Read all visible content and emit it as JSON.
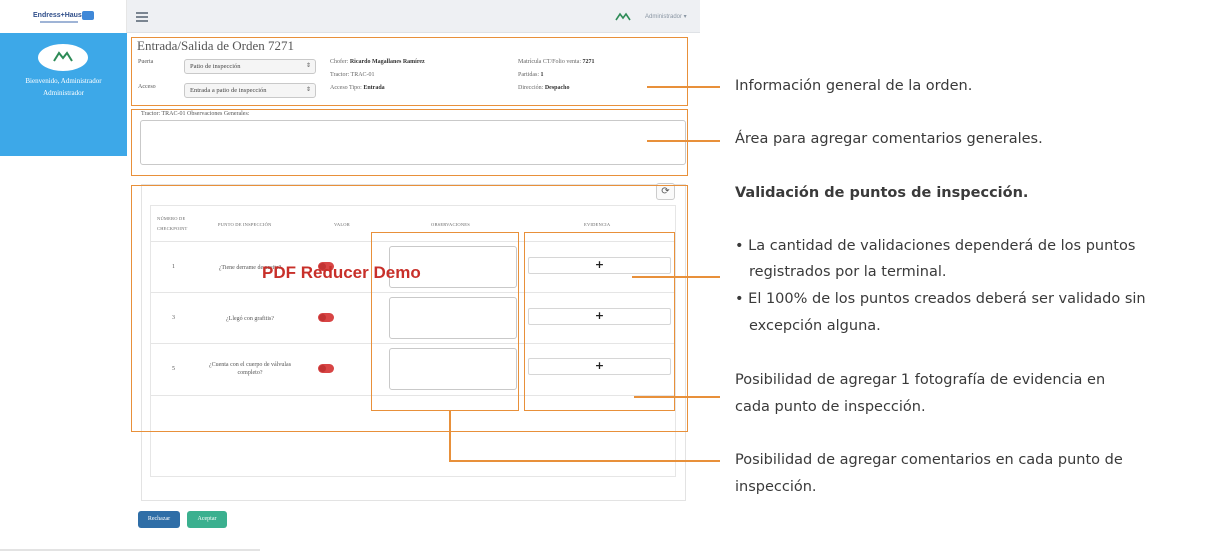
{
  "app": {
    "brand": "Endress+Hauser",
    "admin_menu": "Administrador ▾",
    "sidebar": {
      "welcome_line1": "Bienvenido, Administrador",
      "welcome_line2": "Administrador"
    },
    "page_title": "Entrada/Salida de Orden 7271",
    "form": {
      "puerta_label": "Puerta",
      "puerta_value": "Patio de inspección",
      "acceso_label": "Acceso",
      "acceso_value": "Entrada a patio de inspección",
      "chofer_label": "Chofer:",
      "chofer_value": "Ricardo Magallanes Ramírez",
      "tractor_label": "Tractor:",
      "tractor_value": "TRAC-01",
      "acceso_tipo_label": "Acceso Tipo:",
      "acceso_tipo_value": "Entrada",
      "matricula_label": "Matrícula CT/Folio venta:",
      "matricula_value": "7271",
      "partidas_label": "Partidas:",
      "partidas_value": "1",
      "direccion_label": "Dirección:",
      "direccion_value": "Despacho"
    },
    "observations_label": "Tractor: TRAC-01 Observaciones Generales:",
    "table": {
      "headers": {
        "numero": "Número de checkpoint",
        "punto": "Punto de inspección",
        "valor": "Valor",
        "observaciones": "Observaciones",
        "evidencia": "Evidencia"
      },
      "rows": [
        {
          "num": "1",
          "point": "¿Tiene derrame de aceite?"
        },
        {
          "num": "3",
          "point": "¿Llegó con grafitis?"
        },
        {
          "num": "5",
          "point": "¿Cuenta con el cuerpo de válvulas completo?"
        }
      ],
      "evidence_symbol": "+",
      "refresh_symbol": "⟳"
    },
    "buttons": {
      "reject": "Rechazar",
      "accept": "Aceptar"
    },
    "watermark": "PDF Reducer Demo"
  },
  "annotations": {
    "general_info": "Información general de la orden.",
    "general_comments": "Área para agregar comentarios generales.",
    "validation_title": "Validación de puntos de inspección.",
    "bullet1_line1": "• La cantidad de validaciones dependerá de los puntos",
    "bullet1_line2": "registrados por la terminal.",
    "bullet2_line1": "• El 100% de los puntos creados deberá ser validado sin",
    "bullet2_line2": "excepción alguna.",
    "photo_line1": "Posibilidad  de agregar 1 fotografía de evidencia en",
    "photo_line2": "cada punto de inspección.",
    "comments_line1": "Posibilidad de agregar comentarios en cada punto de",
    "comments_line2": "inspección."
  },
  "colors": {
    "annotation_orange": "#e8903a",
    "sidebar_blue": "#3da8e8",
    "reject_blue": "#2f6ea7",
    "accept_green": "#3bb08f",
    "toggle_red": "#d84545"
  }
}
